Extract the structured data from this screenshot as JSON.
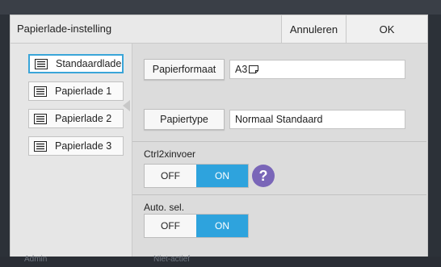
{
  "dialog": {
    "title": "Papierlade-instelling",
    "cancel_label": "Annuleren",
    "ok_label": "OK"
  },
  "trays": [
    {
      "label": "Standaardlade",
      "selected": true
    },
    {
      "label": "Papierlade 1",
      "selected": false
    },
    {
      "label": "Papierlade 2",
      "selected": false
    },
    {
      "label": "Papierlade 3",
      "selected": false
    }
  ],
  "settings": {
    "paper_size_button": "Papierformaat",
    "paper_size_value": "A3",
    "paper_type_button": "Papiertype",
    "paper_type_value": "Normaal Standaard",
    "ctrl2x_label": "Ctrl2xinvoer",
    "ctrl2x_off": "OFF",
    "ctrl2x_on": "ON",
    "ctrl2x_state": "ON",
    "auto_sel_label": "Auto. sel.",
    "auto_sel_off": "OFF",
    "auto_sel_on": "ON",
    "auto_sel_state": "ON",
    "help_symbol": "?"
  },
  "background": {
    "bottom_left_text": "Admin",
    "bottom_mid_text": "Niet-actief"
  },
  "colors": {
    "accent": "#2ea3dd",
    "selected_border": "#3aa5d8",
    "help_bg": "#7a66b8"
  },
  "icons": {
    "tray": "tray-list-icon",
    "orientation": "landscape-page-icon",
    "help": "question-icon"
  }
}
